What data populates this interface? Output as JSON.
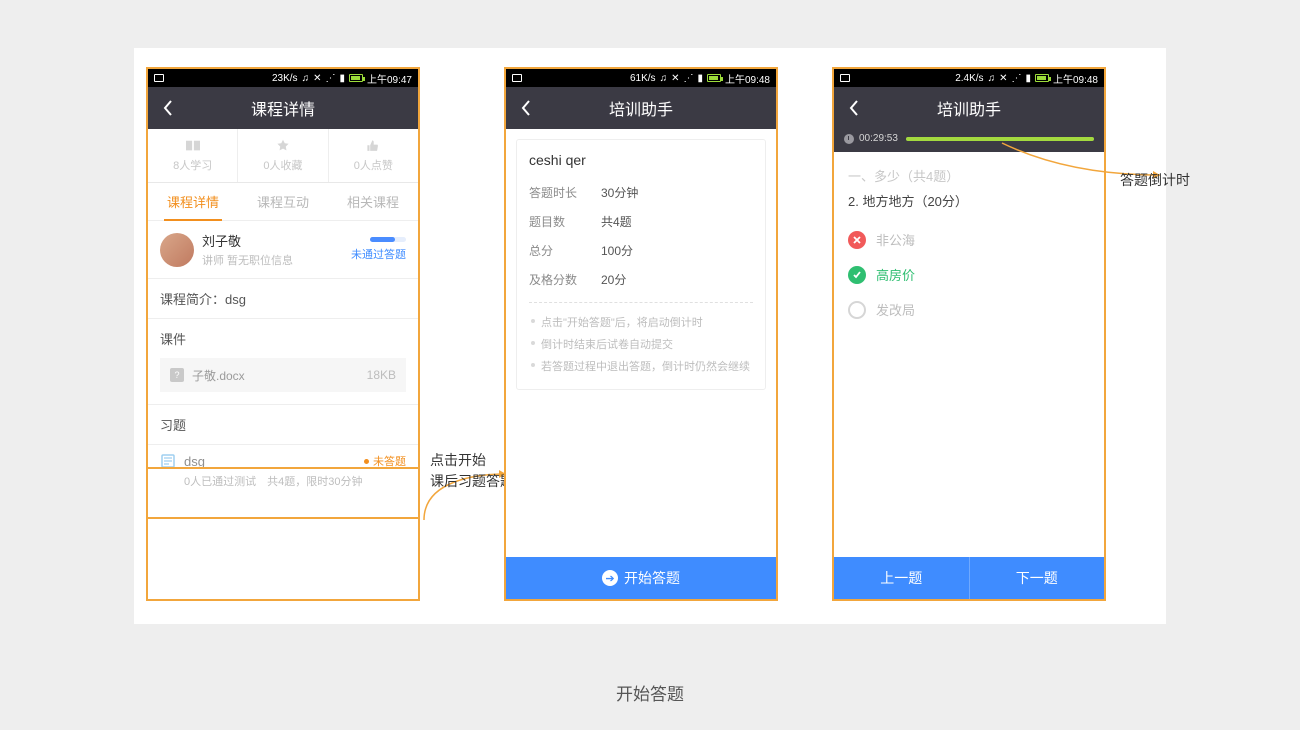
{
  "caption": "开始答题",
  "annotations": {
    "a1_l1": "点击开始",
    "a1_l2": "课后习题答题",
    "a2": "答题倒计时"
  },
  "phone1": {
    "statusbar": {
      "speed": "23K/s",
      "time": "上午09:47"
    },
    "title": "课程详情",
    "stats": {
      "study": "8人学习",
      "fav": "0人收藏",
      "like": "0人点赞"
    },
    "tabs": {
      "t1": "课程详情",
      "t2": "课程互动",
      "t3": "相关课程"
    },
    "instructor": {
      "name": "刘子敬",
      "sub": "讲师 暂无职位信息",
      "status": "未通过答题"
    },
    "intro": "课程简介：dsg",
    "kejian_head": "课件",
    "file": {
      "name": "子敬.docx",
      "size": "18KB"
    },
    "xiti_head": "习题",
    "quiz": {
      "title": "dsg",
      "status": "未答题",
      "sub": "0人已通过测试　共4题，限时30分钟"
    }
  },
  "phone2": {
    "statusbar": {
      "speed": "61K/s",
      "time": "上午09:48"
    },
    "title": "培训助手",
    "card_title": "ceshi qer",
    "rows": {
      "r1k": "答题时长",
      "r1v": "30分钟",
      "r2k": "题目数",
      "r2v": "共4题",
      "r3k": "总分",
      "r3v": "100分",
      "r4k": "及格分数",
      "r4v": "20分"
    },
    "tips": {
      "t1": "点击\"开始答题\"后，将启动倒计时",
      "t2": "倒计时结束后试卷自动提交",
      "t3": "若答题过程中退出答题，倒计时仍然会继续"
    },
    "start": "开始答题"
  },
  "phone3": {
    "statusbar": {
      "speed": "2.4K/s",
      "time": "上午09:48"
    },
    "title": "培训助手",
    "timer": "00:29:53",
    "section": "一、多少（共4题）",
    "question": "2. 地方地方（20分）",
    "opts": {
      "o1": "非公海",
      "o2": "高房价",
      "o3": "发改局"
    },
    "prev": "上一题",
    "next": "下一题"
  }
}
